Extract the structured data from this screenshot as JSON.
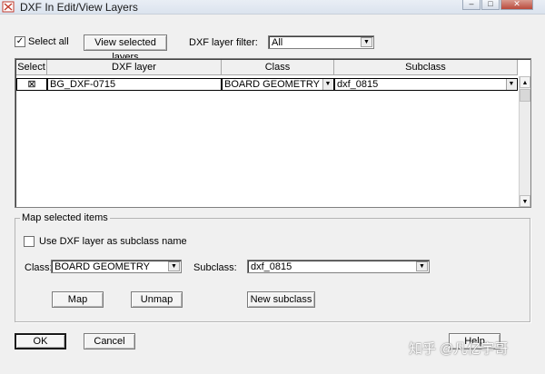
{
  "window": {
    "title": "DXF In Edit/View Layers",
    "minimize_glyph": "–",
    "maximize_glyph": "□",
    "close_glyph": "✕"
  },
  "top": {
    "select_all_label": "Select all",
    "select_all_checked": true,
    "view_selected_label": "View selected layers",
    "filter_label": "DXF layer filter:",
    "filter_value": "All"
  },
  "grid": {
    "columns": [
      "Select",
      "DXF layer",
      "Class",
      "Subclass"
    ],
    "rows": [
      {
        "selected": true,
        "dxf_layer": "BG_DXF-0715",
        "class": "BOARD GEOMETRY",
        "subclass": "dxf_0815"
      }
    ]
  },
  "map_group": {
    "title": "Map selected items",
    "use_dxf_label": "Use DXF layer as subclass name",
    "use_dxf_checked": false,
    "class_label": "Class:",
    "class_value": "BOARD GEOMETRY",
    "subclass_label": "Subclass:",
    "subclass_value": "dxf_0815",
    "map_button": "Map",
    "unmap_button": "Unmap",
    "new_subclass_button": "New subclass"
  },
  "footer": {
    "ok": "OK",
    "cancel": "Cancel",
    "help": "Help"
  },
  "watermark": "知乎 @凡亿宇哥",
  "icons": {
    "check_glyph": "✓",
    "row_mark_glyph": "⊠",
    "dropdown_glyph": "▼",
    "scroll_up_glyph": "▲",
    "scroll_down_glyph": "▼"
  }
}
